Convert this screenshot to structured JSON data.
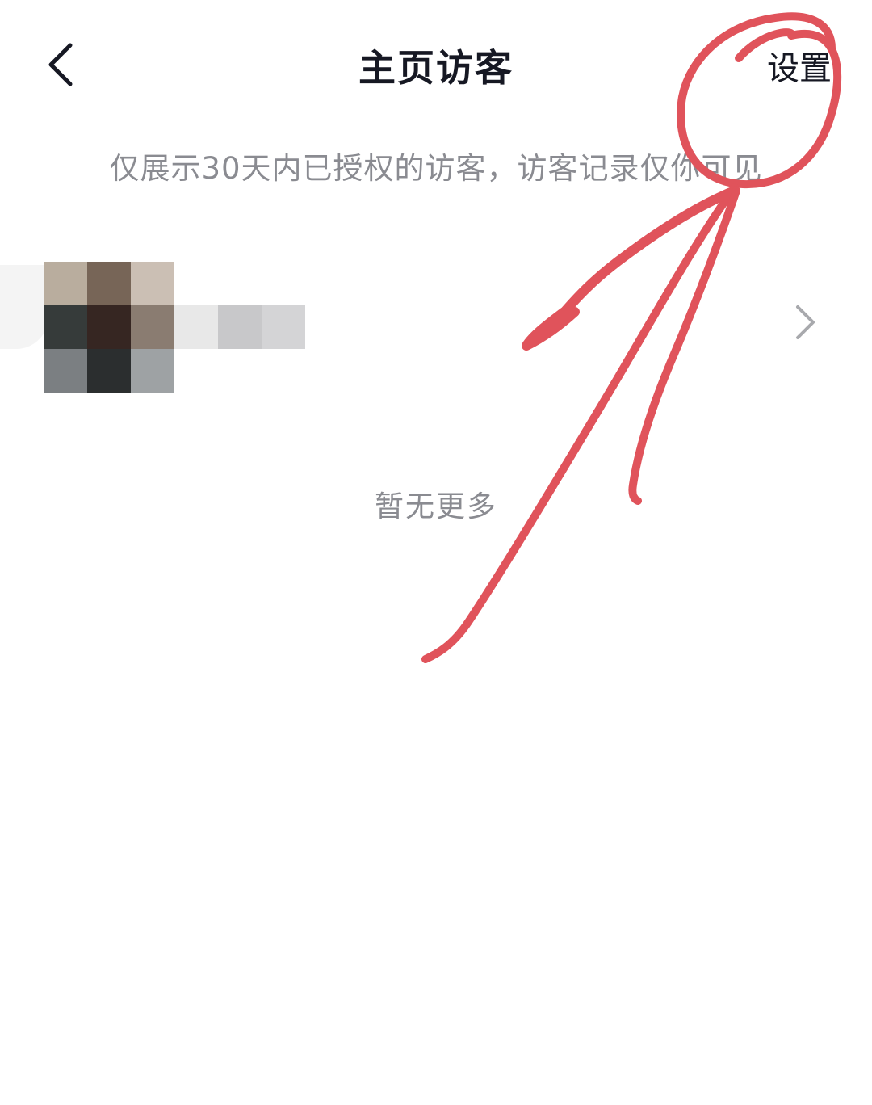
{
  "header": {
    "back_icon": "chevron-left-icon",
    "title": "主页访客",
    "settings_label": "设置"
  },
  "notice": "仅展示30天内已授权的访客，访客记录仅你可见",
  "visitor_list": {
    "items": [
      {
        "avatar": "pixelated-avatar",
        "name": "",
        "chevron_icon": "chevron-right-icon"
      }
    ]
  },
  "footer_text": "暂无更多",
  "colors": {
    "title": "#161823",
    "secondary_text": "#8a8b91",
    "annotation": "#e0535b",
    "background": "#ffffff"
  }
}
